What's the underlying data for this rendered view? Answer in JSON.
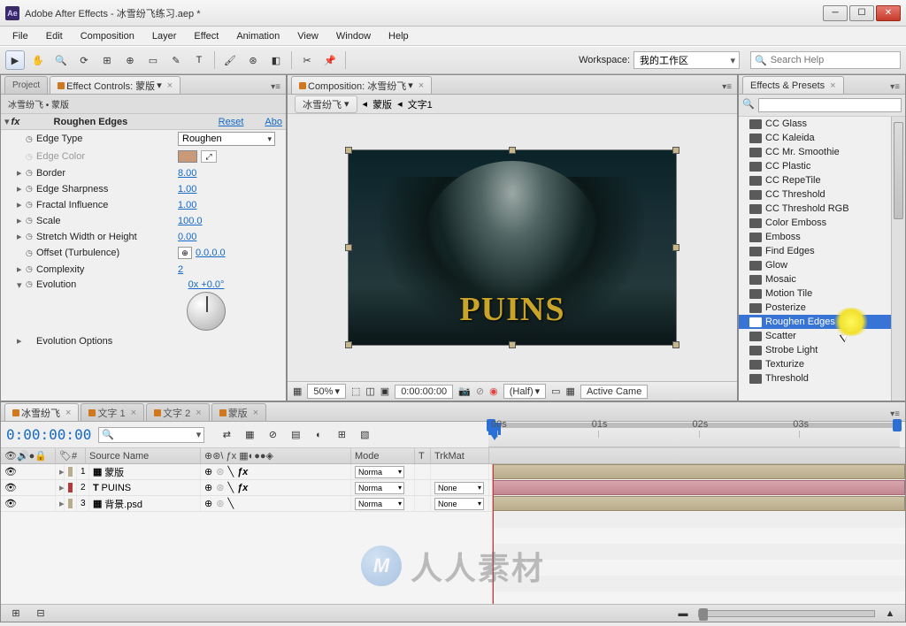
{
  "app": {
    "title": "Adobe After Effects - 冰雪纷飞练习.aep *",
    "icon_text": "Ae"
  },
  "menu": [
    "File",
    "Edit",
    "Composition",
    "Layer",
    "Effect",
    "Animation",
    "View",
    "Window",
    "Help"
  ],
  "workspace": {
    "label": "Workspace:",
    "value": "我的工作区",
    "search": "Search Help"
  },
  "project_tab": "Project",
  "effect_controls": {
    "tab": "Effect Controls: 蒙版",
    "sub": "冰雪纷飞 • 蒙版",
    "fx_label": "fx",
    "fx_name": "Roughen Edges",
    "reset": "Reset",
    "about": "Abo",
    "props": {
      "edge_type": {
        "label": "Edge Type",
        "value": "Roughen"
      },
      "edge_color": {
        "label": "Edge Color"
      },
      "border": {
        "label": "Border",
        "value": "8.00"
      },
      "sharpness": {
        "label": "Edge Sharpness",
        "value": "1.00"
      },
      "fractal": {
        "label": "Fractal Influence",
        "value": "1.00"
      },
      "scale": {
        "label": "Scale",
        "value": "100.0"
      },
      "stretch": {
        "label": "Stretch Width or Height",
        "value": "0.00"
      },
      "offset": {
        "label": "Offset (Turbulence)",
        "value": "0.0,0.0"
      },
      "complexity": {
        "label": "Complexity",
        "value": "2"
      },
      "evolution": {
        "label": "Evolution",
        "value": "0x +0.0°"
      },
      "evo_opts": {
        "label": "Evolution Options"
      }
    }
  },
  "composition": {
    "tab": "Composition: 冰雪纷飞",
    "breadcrumb": [
      "冰雪纷飞",
      "蒙版",
      "文字1"
    ],
    "preview_text": "PUINS",
    "viewer": {
      "mag": "50%",
      "time": "0:00:00:00",
      "res": "(Half)",
      "camera": "Active Came"
    }
  },
  "effects_presets": {
    "tab": "Effects & Presets",
    "items": [
      "CC Glass",
      "CC Kaleida",
      "CC Mr. Smoothie",
      "CC Plastic",
      "CC RepeTile",
      "CC Threshold",
      "CC Threshold RGB",
      "Color Emboss",
      "Emboss",
      "Find Edges",
      "Glow",
      "Mosaic",
      "Motion Tile",
      "Posterize",
      "Roughen Edges",
      "Scatter",
      "Strobe Light",
      "Texturize",
      "Threshold"
    ],
    "selected_index": 14
  },
  "timeline": {
    "tabs": [
      "冰雪纷飞",
      "文字 1",
      "文字 2",
      "蒙版"
    ],
    "timecode": "0:00:00:00",
    "cols": {
      "num": "#",
      "source": "Source Name",
      "mode": "Mode",
      "trkmat": "TrkMat"
    },
    "ruler": [
      "00s",
      "01s",
      "02s",
      "03s"
    ],
    "layers": [
      {
        "n": "1",
        "color": "#b9ac8b",
        "icon": "▦",
        "name": "蒙版",
        "fx": true,
        "mode": "Norma",
        "trk": ""
      },
      {
        "n": "2",
        "color": "#b33a3a",
        "icon": "T",
        "name": "PUINS",
        "fx": true,
        "mode": "Norma",
        "trk": "None"
      },
      {
        "n": "3",
        "color": "#b9ac8b",
        "icon": "▦",
        "name": "背景.psd",
        "fx": false,
        "mode": "Norma",
        "trk": "None"
      }
    ]
  },
  "watermark": {
    "badge": "M",
    "text": "人人素材"
  }
}
